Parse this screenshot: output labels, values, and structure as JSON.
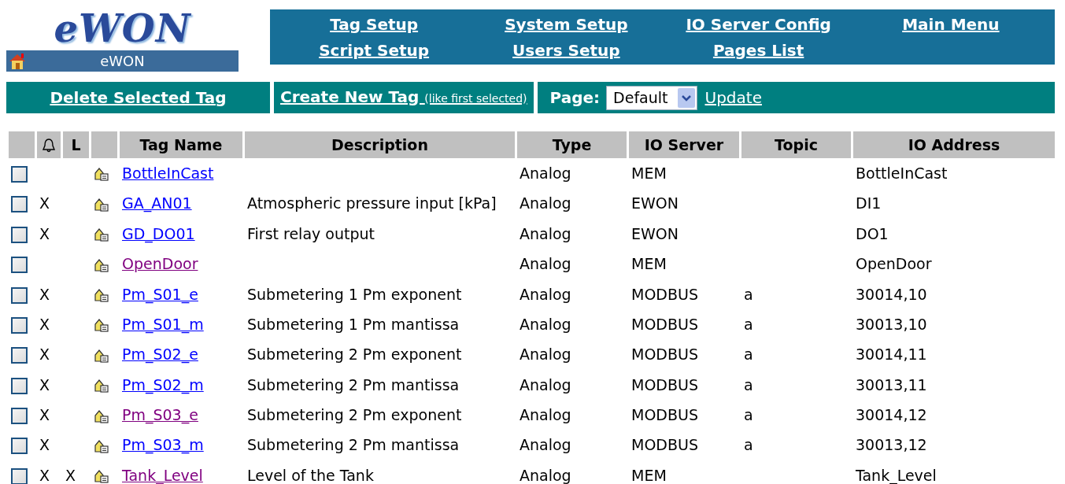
{
  "logo": {
    "text": "eWON",
    "caption": "eWON"
  },
  "nav_links": [
    {
      "label": "Tag Setup"
    },
    {
      "label": "System Setup"
    },
    {
      "label": "IO Server Config"
    },
    {
      "label": "Main Menu"
    },
    {
      "label": "Script Setup"
    },
    {
      "label": "Users Setup"
    },
    {
      "label": "Pages List"
    }
  ],
  "toolbar": {
    "delete": "Delete Selected Tag",
    "create": "Create New Tag",
    "create_note": "(like first selected)",
    "page_label": "Page:",
    "page_value": "Default",
    "update": "Update"
  },
  "table": {
    "columns": [
      "",
      "",
      "L",
      "",
      "Tag Name",
      "Description",
      "Type",
      "IO Server",
      "Topic",
      "IO Address"
    ],
    "rows": [
      {
        "checked": false,
        "alarm": "",
        "log": "",
        "name": "BottleInCast",
        "visited": false,
        "description": "",
        "type": "Analog",
        "io_server": "MEM",
        "topic": "",
        "io_address": "BottleInCast"
      },
      {
        "checked": false,
        "alarm": "X",
        "log": "",
        "name": "GA_AN01",
        "visited": false,
        "description": "Atmospheric pressure input [kPa]",
        "type": "Analog",
        "io_server": "EWON",
        "topic": "",
        "io_address": "DI1"
      },
      {
        "checked": false,
        "alarm": "X",
        "log": "",
        "name": "GD_DO01",
        "visited": false,
        "description": "First relay output",
        "type": "Analog",
        "io_server": "EWON",
        "topic": "",
        "io_address": "DO1"
      },
      {
        "checked": false,
        "alarm": "",
        "log": "",
        "name": "OpenDoor",
        "visited": true,
        "description": "",
        "type": "Analog",
        "io_server": "MEM",
        "topic": "",
        "io_address": "OpenDoor"
      },
      {
        "checked": false,
        "alarm": "X",
        "log": "",
        "name": "Pm_S01_e",
        "visited": false,
        "description": "Submetering 1 Pm exponent",
        "type": "Analog",
        "io_server": "MODBUS",
        "topic": "a",
        "io_address": "30014,10"
      },
      {
        "checked": false,
        "alarm": "X",
        "log": "",
        "name": "Pm_S01_m",
        "visited": false,
        "description": "Submetering 1 Pm mantissa",
        "type": "Analog",
        "io_server": "MODBUS",
        "topic": "a",
        "io_address": "30013,10"
      },
      {
        "checked": false,
        "alarm": "X",
        "log": "",
        "name": "Pm_S02_e",
        "visited": false,
        "description": "Submetering 2 Pm exponent",
        "type": "Analog",
        "io_server": "MODBUS",
        "topic": "a",
        "io_address": "30014,11"
      },
      {
        "checked": false,
        "alarm": "X",
        "log": "",
        "name": "Pm_S02_m",
        "visited": false,
        "description": "Submetering 2 Pm mantissa",
        "type": "Analog",
        "io_server": "MODBUS",
        "topic": "a",
        "io_address": "30013,11"
      },
      {
        "checked": false,
        "alarm": "X",
        "log": "",
        "name": "Pm_S03_e",
        "visited": true,
        "description": "Submetering 2 Pm exponent",
        "type": "Analog",
        "io_server": "MODBUS",
        "topic": "a",
        "io_address": "30014,12"
      },
      {
        "checked": false,
        "alarm": "X",
        "log": "",
        "name": "Pm_S03_m",
        "visited": false,
        "description": "Submetering 2 Pm mantissa",
        "type": "Analog",
        "io_server": "MODBUS",
        "topic": "a",
        "io_address": "30013,12"
      },
      {
        "checked": false,
        "alarm": "X",
        "log": "X",
        "name": "Tank_Level",
        "visited": true,
        "description": "Level of the Tank",
        "type": "Analog",
        "io_server": "MEM",
        "topic": "",
        "io_address": "Tank_Level"
      }
    ]
  }
}
